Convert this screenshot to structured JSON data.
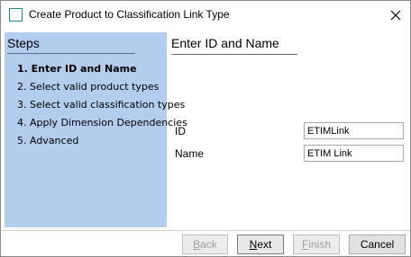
{
  "window": {
    "title": "Create Product to Classification Link Type"
  },
  "sidebar": {
    "title": "Steps",
    "items": [
      {
        "label": "1. Enter ID and Name",
        "active": true
      },
      {
        "label": "2. Select valid product types",
        "active": false
      },
      {
        "label": "3. Select valid classification types",
        "active": false
      },
      {
        "label": "4. Apply Dimension Dependencies",
        "active": false
      },
      {
        "label": "5. Advanced",
        "active": false
      }
    ]
  },
  "main": {
    "header": "Enter ID and Name",
    "fields": {
      "id": {
        "label": "ID",
        "value": "ETIMLink"
      },
      "name": {
        "label": "Name",
        "value": "ETIM Link"
      }
    }
  },
  "footer": {
    "back": {
      "first": "B",
      "rest": "ack",
      "enabled": false
    },
    "next": {
      "first": "N",
      "rest": "ext",
      "enabled": true
    },
    "finish": {
      "first": "F",
      "rest": "inish",
      "enabled": false
    },
    "cancel": {
      "label": "Cancel",
      "enabled": true
    }
  },
  "colors": {
    "sidebar_bg": "#b3cdee",
    "icon_border": "#1a8a8a"
  }
}
